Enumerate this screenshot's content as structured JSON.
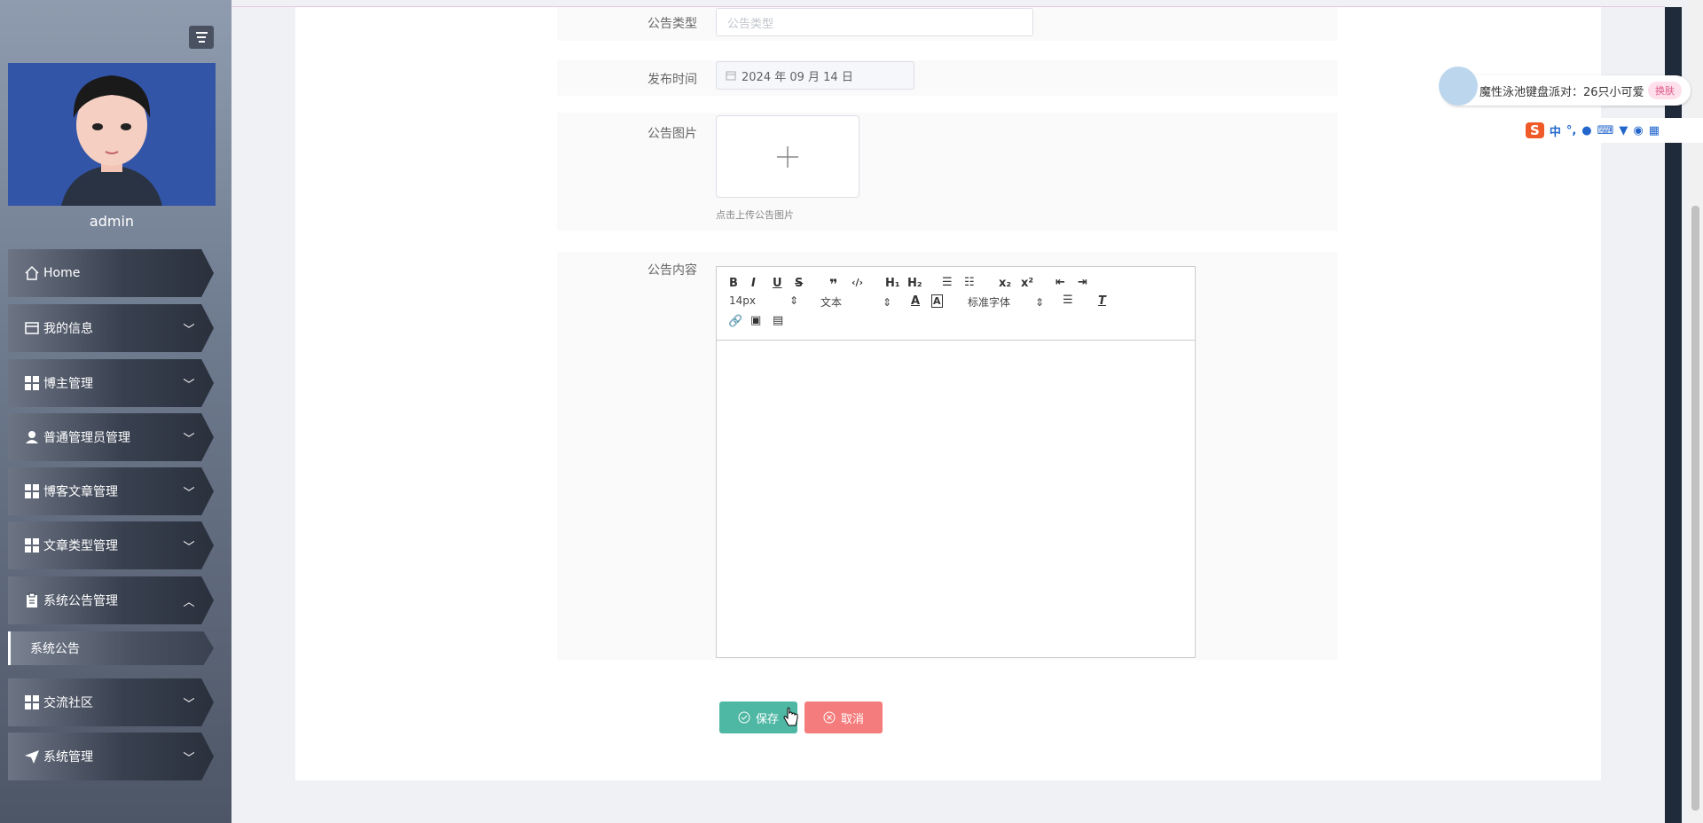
{
  "sidebar": {
    "username": "admin",
    "menu": [
      {
        "label": "Home",
        "icon": "home-icon",
        "expandable": false
      },
      {
        "label": "我的信息",
        "icon": "card-icon",
        "expandable": true
      },
      {
        "label": "博主管理",
        "icon": "grid-icon",
        "expandable": true
      },
      {
        "label": "普通管理员管理",
        "icon": "user-icon",
        "expandable": true
      },
      {
        "label": "博客文章管理",
        "icon": "grid-icon",
        "expandable": true
      },
      {
        "label": "文章类型管理",
        "icon": "grid-icon",
        "expandable": true
      },
      {
        "label": "系统公告管理",
        "icon": "clipboard-icon",
        "expandable": true,
        "expanded": true
      },
      {
        "label": "交流社区",
        "icon": "grid-icon",
        "expandable": true
      },
      {
        "label": "系统管理",
        "icon": "send-icon",
        "expandable": true
      }
    ],
    "submenu": {
      "label": "系统公告"
    }
  },
  "form": {
    "type_label": "公告类型",
    "type_placeholder": "公告类型",
    "date_label": "发布时间",
    "date_value": "2024 年 09 月 14 日",
    "image_label": "公告图片",
    "image_hint": "点击上传公告图片",
    "content_label": "公告内容"
  },
  "editor": {
    "font_size": "14px",
    "text_style": "文本",
    "font_family": "标准字体",
    "buttons": [
      "B",
      "I",
      "U",
      "S",
      "\"",
      "</>",
      "H1",
      "H2",
      "ol",
      "ul",
      "x₂",
      "x²",
      "outdent",
      "indent",
      "A",
      "bg",
      "align",
      "Tx",
      "link",
      "image",
      "video"
    ]
  },
  "actions": {
    "save_label": "保存",
    "cancel_label": "取消"
  },
  "ime": {
    "news_text": "魔性泳池键盘派对：26只小可爱",
    "skin_label": "换肤",
    "lang_label": "中"
  },
  "colors": {
    "save": "#4fb8a4",
    "cancel": "#f57c7c",
    "avatar_bg": "#3355a8"
  }
}
